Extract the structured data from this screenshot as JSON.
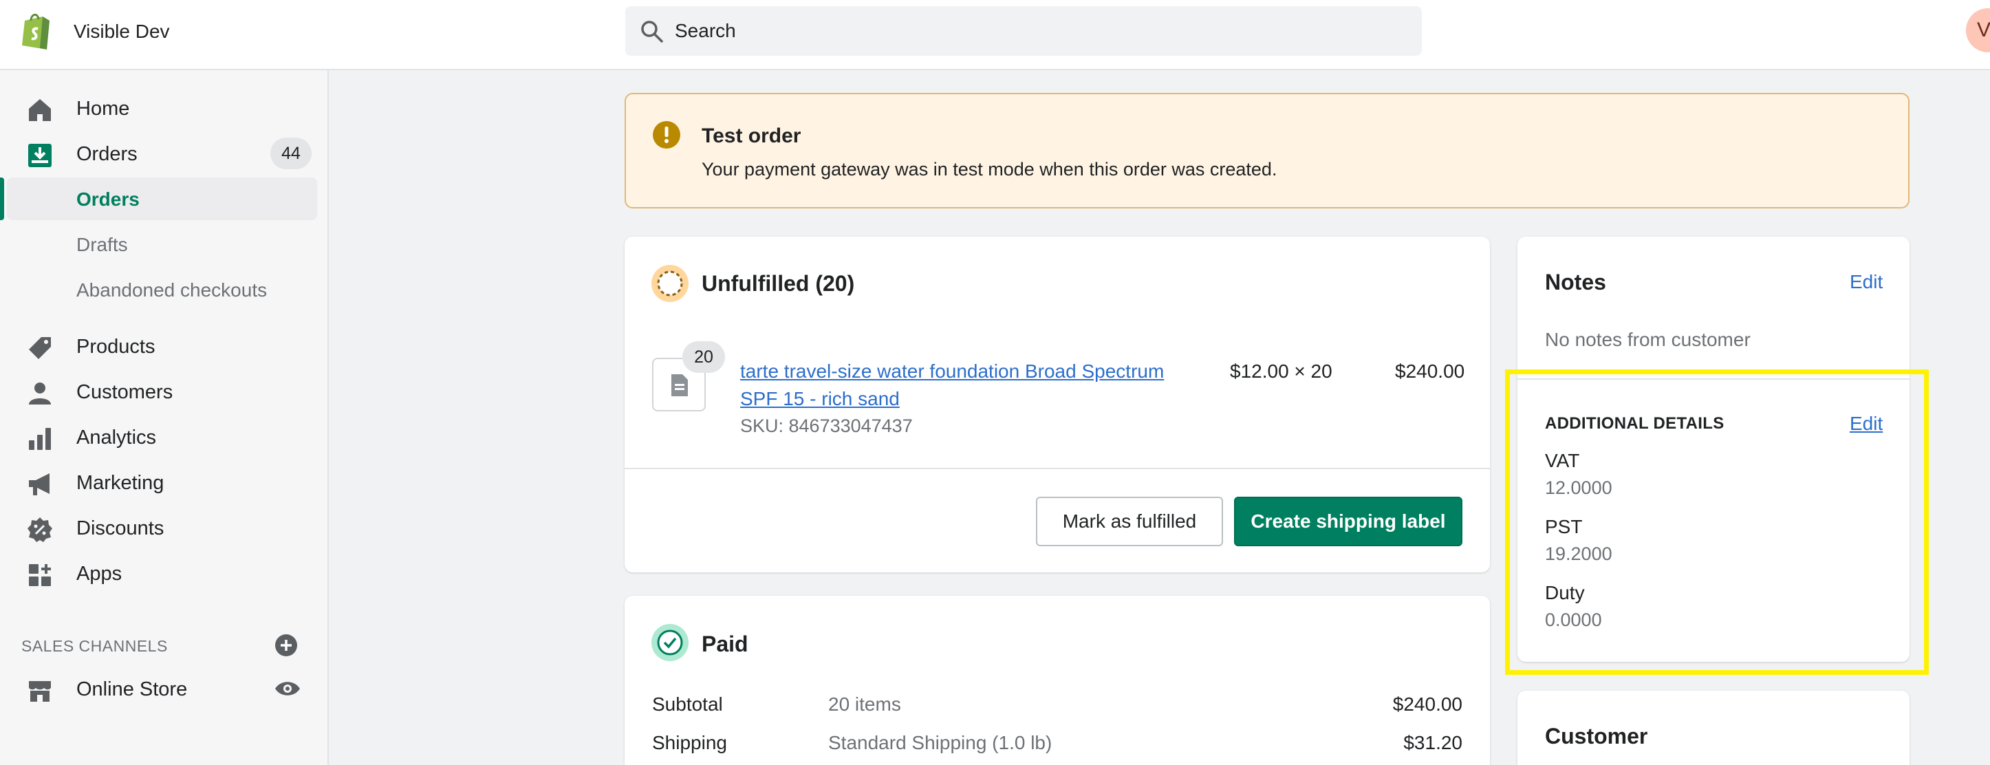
{
  "topbar": {
    "store_name": "Visible Dev",
    "search_placeholder": "Search",
    "avatar_initial": "V"
  },
  "sidebar": {
    "items": [
      {
        "label": "Home",
        "icon": "home-icon"
      },
      {
        "label": "Orders",
        "icon": "orders-icon",
        "badge": "44"
      },
      {
        "label": "Products",
        "icon": "tag-icon"
      },
      {
        "label": "Customers",
        "icon": "person-icon"
      },
      {
        "label": "Analytics",
        "icon": "bar-chart-icon"
      },
      {
        "label": "Marketing",
        "icon": "megaphone-icon"
      },
      {
        "label": "Discounts",
        "icon": "discount-icon"
      },
      {
        "label": "Apps",
        "icon": "apps-icon"
      }
    ],
    "orders_sub": [
      {
        "label": "Orders",
        "active": true
      },
      {
        "label": "Drafts",
        "active": false
      },
      {
        "label": "Abandoned checkouts",
        "active": false
      }
    ],
    "sales_channels_title": "SALES CHANNELS",
    "online_store": "Online Store"
  },
  "banner": {
    "title": "Test order",
    "text": "Your payment gateway was in test mode when this order was created."
  },
  "fulfillment": {
    "title": "Unfulfilled (20)",
    "item": {
      "quantity": "20",
      "name": "tarte travel-size water foundation Broad Spectrum SPF 15 - rich sand",
      "sku": "SKU: 846733047437",
      "unit_price": "$12.00 × 20",
      "total": "$240.00"
    },
    "mark_fulfilled": "Mark as fulfilled",
    "create_label": "Create shipping label"
  },
  "payment": {
    "title": "Paid",
    "rows": [
      {
        "label": "Subtotal",
        "desc": "20 items",
        "amount": "$240.00"
      },
      {
        "label": "Shipping",
        "desc": "Standard Shipping (1.0 lb)",
        "amount": "$31.20"
      }
    ]
  },
  "notes": {
    "title": "Notes",
    "edit": "Edit",
    "empty": "No notes from customer"
  },
  "additional": {
    "title": "ADDITIONAL DETAILS",
    "edit": "Edit",
    "rows": [
      {
        "key": "VAT",
        "value": "12.0000"
      },
      {
        "key": "PST",
        "value": "19.2000"
      },
      {
        "key": "Duty",
        "value": "0.0000"
      }
    ]
  },
  "customer": {
    "title": "Customer"
  },
  "colors": {
    "accent": "#008060",
    "link": "#2c6ecb",
    "highlight": "#fff200"
  }
}
